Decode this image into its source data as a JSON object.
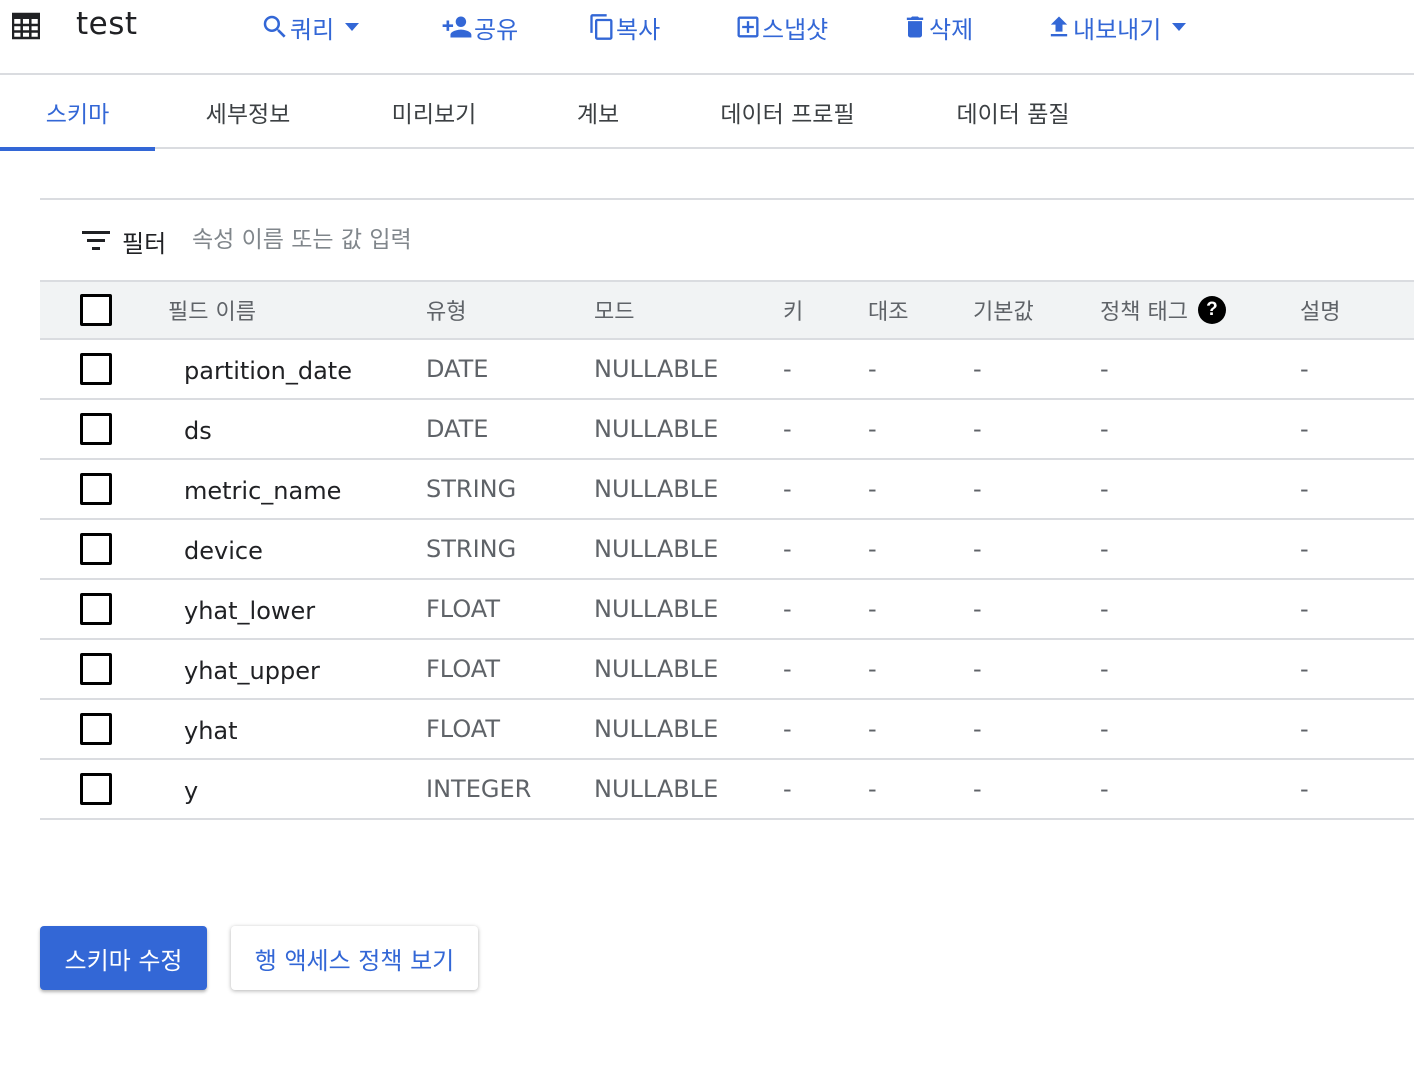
{
  "header": {
    "title": "test",
    "table_icon": "table-grid-icon",
    "actions": [
      {
        "label": "쿼리",
        "icon": "search-icon",
        "has_dropdown": true
      },
      {
        "label": "공유",
        "icon": "person-add-icon",
        "has_dropdown": false
      },
      {
        "label": "복사",
        "icon": "copy-icon",
        "has_dropdown": false
      },
      {
        "label": "스냅샷",
        "icon": "snapshot-icon",
        "has_dropdown": false
      },
      {
        "label": "삭제",
        "icon": "trash-icon",
        "has_dropdown": false
      },
      {
        "label": "내보내기",
        "icon": "upload-icon",
        "has_dropdown": true
      }
    ]
  },
  "tabs": [
    {
      "label": "스키마",
      "active": true
    },
    {
      "label": "세부정보",
      "active": false
    },
    {
      "label": "미리보기",
      "active": false
    },
    {
      "label": "계보",
      "active": false
    },
    {
      "label": "데이터 프로필",
      "active": false
    },
    {
      "label": "데이터 품질",
      "active": false
    }
  ],
  "filter": {
    "label": "필터",
    "placeholder": "속성 이름 또는 값 입력"
  },
  "table": {
    "columns": [
      "필드 이름",
      "유형",
      "모드",
      "키",
      "대조",
      "기본값",
      "정책 태그",
      "설명"
    ],
    "rows": [
      {
        "name": "partition_date",
        "type": "DATE",
        "mode": "NULLABLE",
        "key": "-",
        "collation": "-",
        "default": "-",
        "policy_tags": "-",
        "description": "-"
      },
      {
        "name": "ds",
        "type": "DATE",
        "mode": "NULLABLE",
        "key": "-",
        "collation": "-",
        "default": "-",
        "policy_tags": "-",
        "description": "-"
      },
      {
        "name": "metric_name",
        "type": "STRING",
        "mode": "NULLABLE",
        "key": "-",
        "collation": "-",
        "default": "-",
        "policy_tags": "-",
        "description": "-"
      },
      {
        "name": "device",
        "type": "STRING",
        "mode": "NULLABLE",
        "key": "-",
        "collation": "-",
        "default": "-",
        "policy_tags": "-",
        "description": "-"
      },
      {
        "name": "yhat_lower",
        "type": "FLOAT",
        "mode": "NULLABLE",
        "key": "-",
        "collation": "-",
        "default": "-",
        "policy_tags": "-",
        "description": "-"
      },
      {
        "name": "yhat_upper",
        "type": "FLOAT",
        "mode": "NULLABLE",
        "key": "-",
        "collation": "-",
        "default": "-",
        "policy_tags": "-",
        "description": "-"
      },
      {
        "name": "yhat",
        "type": "FLOAT",
        "mode": "NULLABLE",
        "key": "-",
        "collation": "-",
        "default": "-",
        "policy_tags": "-",
        "description": "-"
      },
      {
        "name": "y",
        "type": "INTEGER",
        "mode": "NULLABLE",
        "key": "-",
        "collation": "-",
        "default": "-",
        "policy_tags": "-",
        "description": "-"
      }
    ]
  },
  "buttons": {
    "edit_schema": "스키마 수정",
    "row_access_policy": "행 액세스 정책 보기"
  },
  "colors": {
    "accent": "#3367d6",
    "divider": "#dadce0",
    "header_bg": "#f1f3f4"
  }
}
